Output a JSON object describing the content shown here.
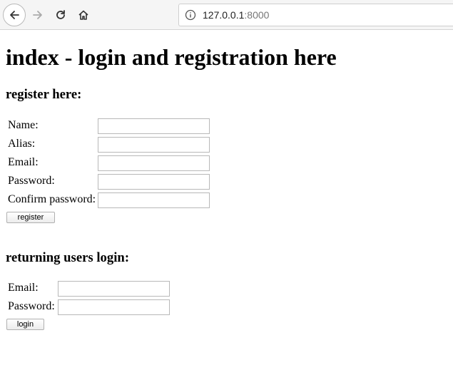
{
  "browser": {
    "url_host": "127.0.0.1",
    "url_port": ":8000",
    "icons": {
      "back": "back-arrow-icon",
      "forward": "forward-arrow-icon",
      "reload": "reload-icon",
      "home": "home-icon",
      "site_info": "info-icon"
    }
  },
  "page": {
    "title": "index - login and registration here",
    "register": {
      "heading": "register here:",
      "name_label": "Name:",
      "alias_label": "Alias:",
      "email_label": "Email:",
      "password_label": "Password:",
      "confirm_label": "Confirm password:",
      "submit_label": "register"
    },
    "login": {
      "heading": "returning users login:",
      "email_label": "Email:",
      "password_label": "Password:",
      "submit_label": "login"
    }
  }
}
